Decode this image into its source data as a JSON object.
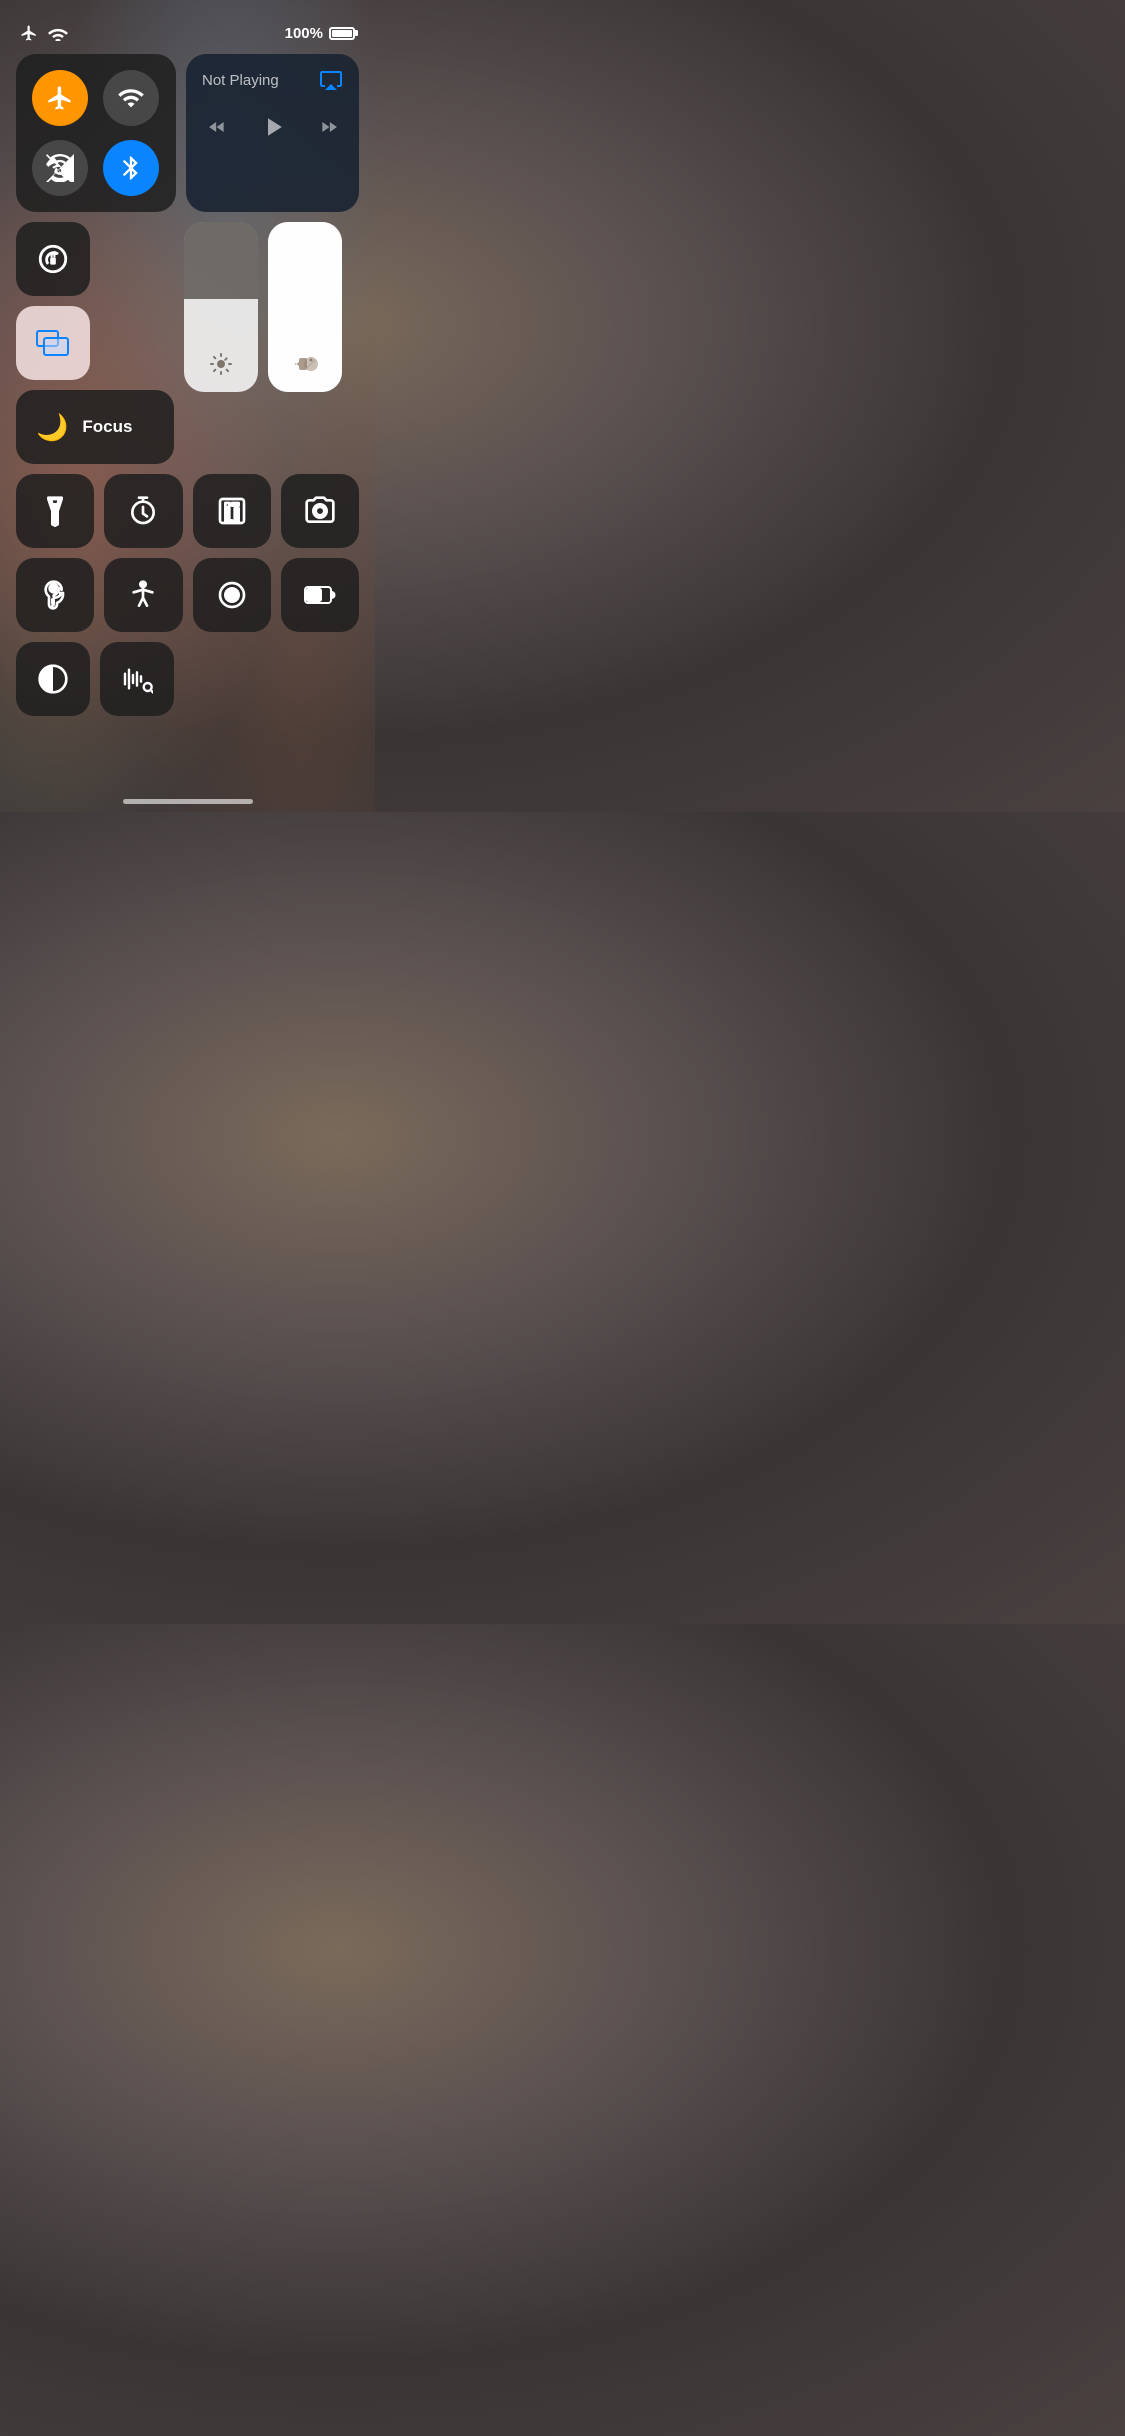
{
  "statusBar": {
    "batteryPercent": "100%",
    "airplaneMode": true,
    "wifi": true
  },
  "connectivityPanel": {
    "buttons": [
      {
        "id": "airplane",
        "label": "Airplane Mode",
        "active": true,
        "color": "orange"
      },
      {
        "id": "cellular",
        "label": "Cellular",
        "active": false,
        "color": "gray"
      },
      {
        "id": "wifi-off",
        "label": "Wi-Fi Off",
        "active": false,
        "color": "gray"
      },
      {
        "id": "bluetooth",
        "label": "Bluetooth",
        "active": true,
        "color": "blue"
      }
    ]
  },
  "nowPlaying": {
    "title": "Not Playing",
    "artist": ""
  },
  "focusMode": {
    "label": "Focus"
  },
  "sliders": {
    "brightness": 55,
    "volume": 100
  },
  "quickButtons": {
    "row1": [
      "Flashlight",
      "Timer",
      "Calculator",
      "Camera"
    ],
    "row2": [
      "Hearing",
      "Accessibility",
      "Screen Record",
      "Battery"
    ],
    "row3": [
      "Dark Mode",
      "Sound Recognition"
    ]
  },
  "homeIndicator": true
}
